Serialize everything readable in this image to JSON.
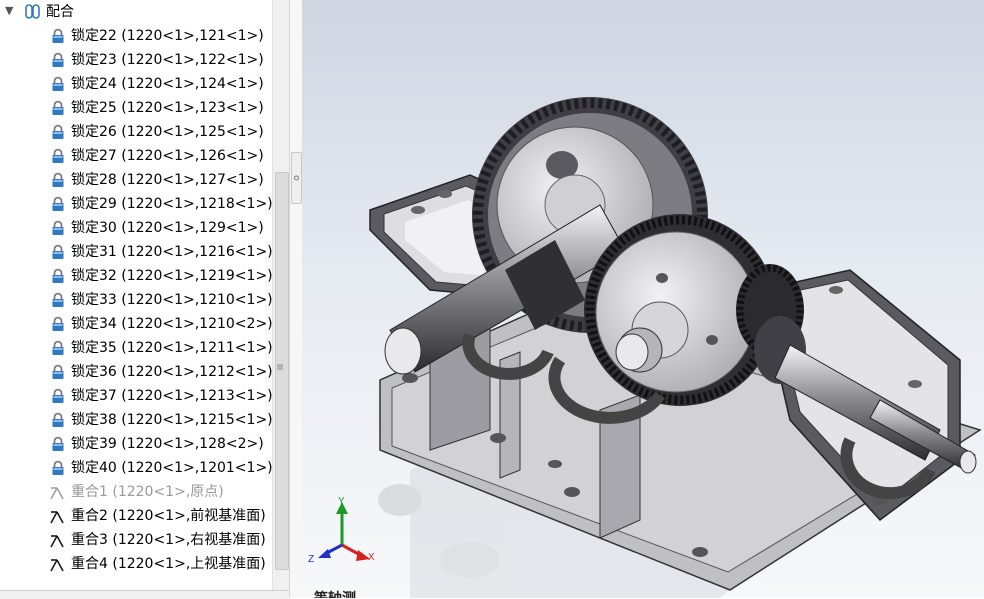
{
  "tree": {
    "root_label": "配合",
    "items": [
      {
        "label": "锁定22 (1220<1>,121<1>)",
        "icon": "lock-icon",
        "suppressed": false
      },
      {
        "label": "锁定23 (1220<1>,122<1>)",
        "icon": "lock-icon",
        "suppressed": false
      },
      {
        "label": "锁定24 (1220<1>,124<1>)",
        "icon": "lock-icon",
        "suppressed": false
      },
      {
        "label": "锁定25 (1220<1>,123<1>)",
        "icon": "lock-icon",
        "suppressed": false
      },
      {
        "label": "锁定26 (1220<1>,125<1>)",
        "icon": "lock-icon",
        "suppressed": false
      },
      {
        "label": "锁定27 (1220<1>,126<1>)",
        "icon": "lock-icon",
        "suppressed": false
      },
      {
        "label": "锁定28 (1220<1>,127<1>)",
        "icon": "lock-icon",
        "suppressed": false
      },
      {
        "label": "锁定29 (1220<1>,1218<1>)",
        "icon": "lock-icon",
        "suppressed": false
      },
      {
        "label": "锁定30 (1220<1>,129<1>)",
        "icon": "lock-icon",
        "suppressed": false
      },
      {
        "label": "锁定31 (1220<1>,1216<1>)",
        "icon": "lock-icon",
        "suppressed": false
      },
      {
        "label": "锁定32 (1220<1>,1219<1>)",
        "icon": "lock-icon",
        "suppressed": false
      },
      {
        "label": "锁定33 (1220<1>,1210<1>)",
        "icon": "lock-icon",
        "suppressed": false
      },
      {
        "label": "锁定34 (1220<1>,1210<2>)",
        "icon": "lock-icon",
        "suppressed": false
      },
      {
        "label": "锁定35 (1220<1>,1211<1>)",
        "icon": "lock-icon",
        "suppressed": false
      },
      {
        "label": "锁定36 (1220<1>,1212<1>)",
        "icon": "lock-icon",
        "suppressed": false
      },
      {
        "label": "锁定37 (1220<1>,1213<1>)",
        "icon": "lock-icon",
        "suppressed": false
      },
      {
        "label": "锁定38 (1220<1>,1215<1>)",
        "icon": "lock-icon",
        "suppressed": false
      },
      {
        "label": "锁定39 (1220<1>,128<2>)",
        "icon": "lock-icon",
        "suppressed": false
      },
      {
        "label": "锁定40 (1220<1>,1201<1>)",
        "icon": "lock-icon",
        "suppressed": false
      },
      {
        "label": "重合1 (1220<1>,原点)",
        "icon": "coincident-icon",
        "suppressed": true
      },
      {
        "label": "重合2 (1220<1>,前视基准面)",
        "icon": "coincident-icon",
        "suppressed": false
      },
      {
        "label": "重合3 (1220<1>,右视基准面)",
        "icon": "coincident-icon",
        "suppressed": false
      },
      {
        "label": "重合4 (1220<1>,上视基准面)",
        "icon": "coincident-icon",
        "suppressed": false
      }
    ]
  },
  "viewport": {
    "view_label": "等轴测",
    "triad": {
      "x": "X",
      "y": "Y",
      "z": "Z"
    }
  },
  "colors": {
    "lock_body": "#2f78c4",
    "triad_x": "#d62020",
    "triad_y": "#1b9a2a",
    "triad_z": "#2030c8",
    "metal_dark": "#4a4a4a",
    "metal_light": "#d8d8dc"
  }
}
